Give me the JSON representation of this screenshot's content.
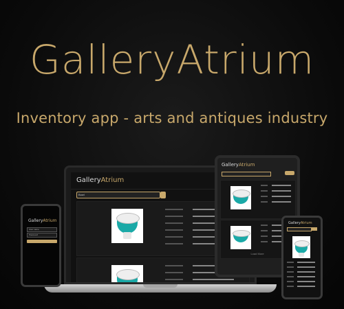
{
  "hero": {
    "brand": "GalleryAtrium",
    "tagline": "Inventory app - arts and antiques industry"
  },
  "app": {
    "logo_prefix": "Gallery",
    "logo_suffix": "Atrium",
    "search_value": "Bowl",
    "accent_color": "#c8a86b",
    "card_icon": "bowl-image"
  },
  "mobile_login": {
    "username_placeholder": "User name",
    "password_placeholder": "Password",
    "login_label": "Login"
  },
  "tablet": {
    "footer": "Load More"
  }
}
